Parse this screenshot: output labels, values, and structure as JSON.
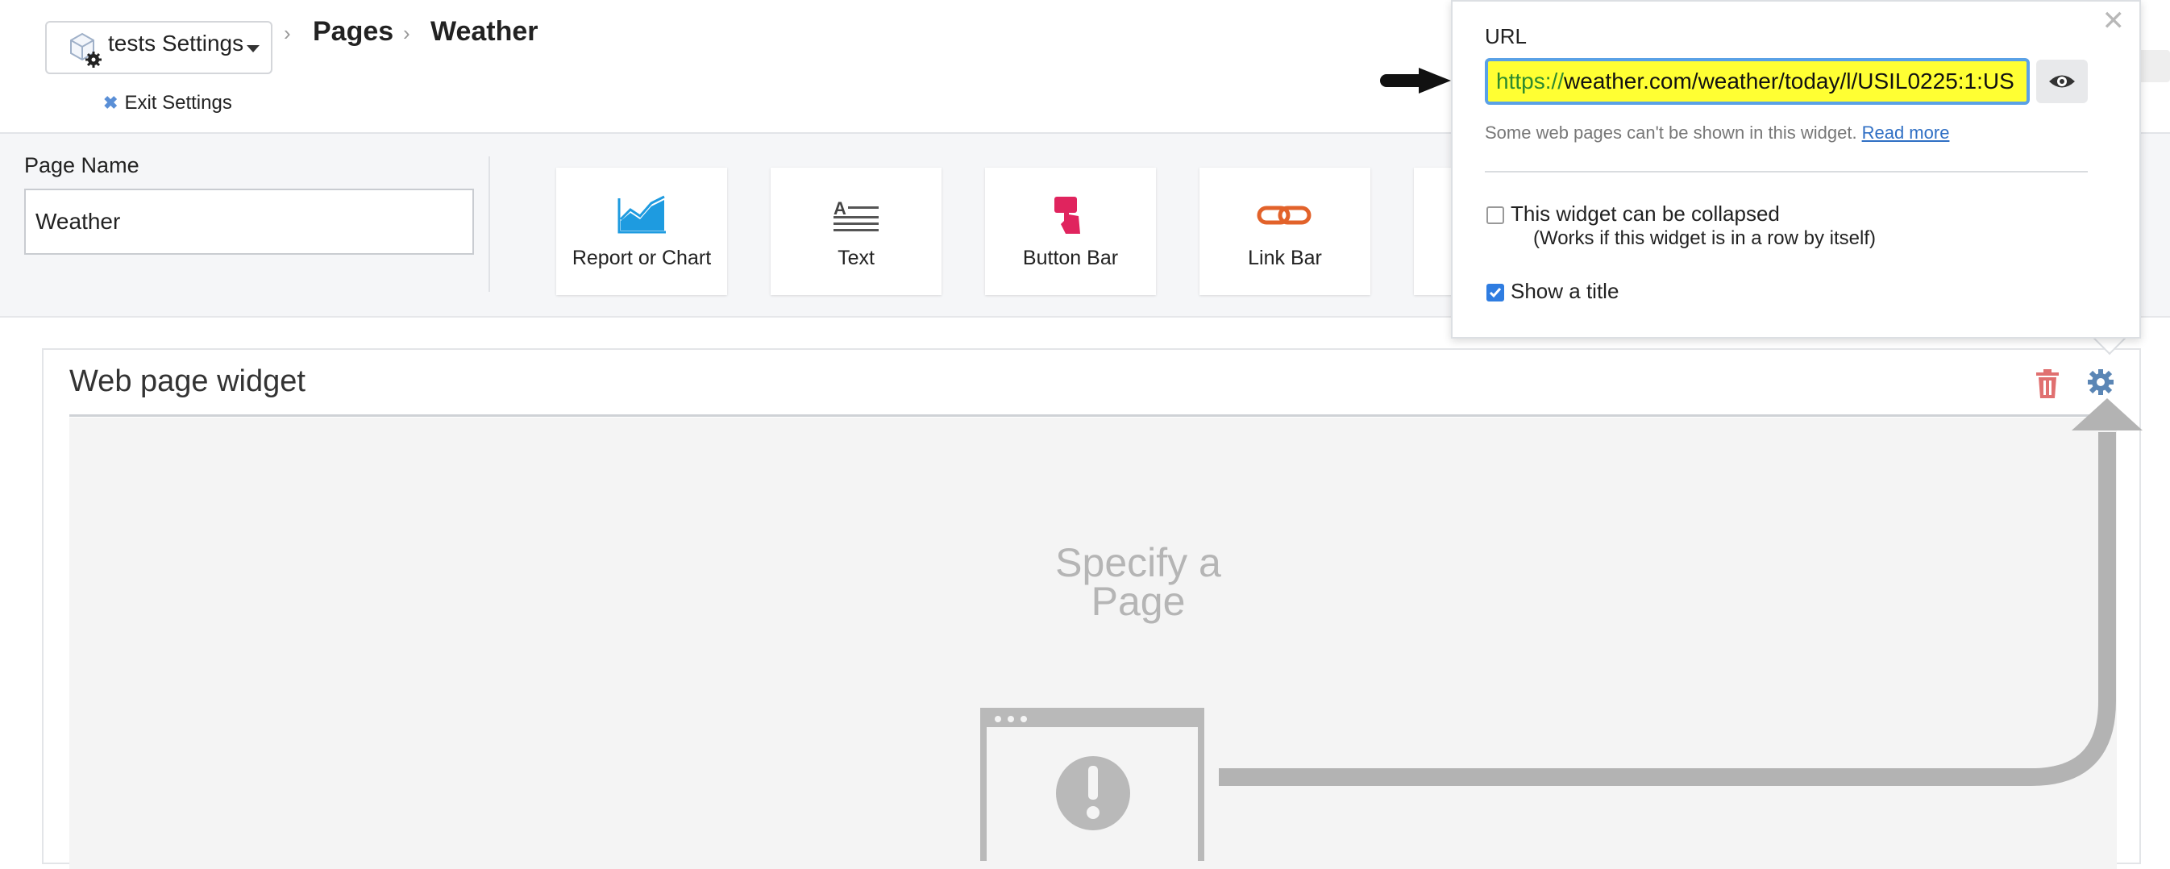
{
  "header": {
    "app_menu_label": "tests Settings",
    "breadcrumb": [
      "Pages",
      "Weather"
    ],
    "exit_label": "Exit Settings",
    "right_fragment": "l"
  },
  "toolbar": {
    "page_name_label": "Page Name",
    "page_name_value": "Weather",
    "widgets": [
      {
        "label": "Report or Chart",
        "icon": "chart-icon"
      },
      {
        "label": "Text",
        "icon": "text-icon"
      },
      {
        "label": "Button Bar",
        "icon": "pointer-hand-icon"
      },
      {
        "label": "Link Bar",
        "icon": "link-icon"
      }
    ]
  },
  "widget": {
    "title": "Web page widget",
    "placeholder_line1": "Specify a",
    "placeholder_line2": "Page"
  },
  "popover": {
    "url_label": "URL",
    "url_scheme": "https://",
    "url_rest": "weather.com/weather/today/l/USIL0225:1:US",
    "note_text": "Some web pages can't be shown in this widget.",
    "note_link": "Read more",
    "collapse_label": "This widget can be collapsed",
    "collapse_sublabel": "(Works if this widget is in a row by itself)",
    "collapse_checked": false,
    "show_title_label": "Show a title",
    "show_title_checked": true
  },
  "colors": {
    "chart_icon": "#1e9be0",
    "button_bar_icon": "#e0245e",
    "link_icon": "#e2622a",
    "trash": "#e07070",
    "gear": "#5b86b5",
    "url_highlight": "#ffff33"
  }
}
